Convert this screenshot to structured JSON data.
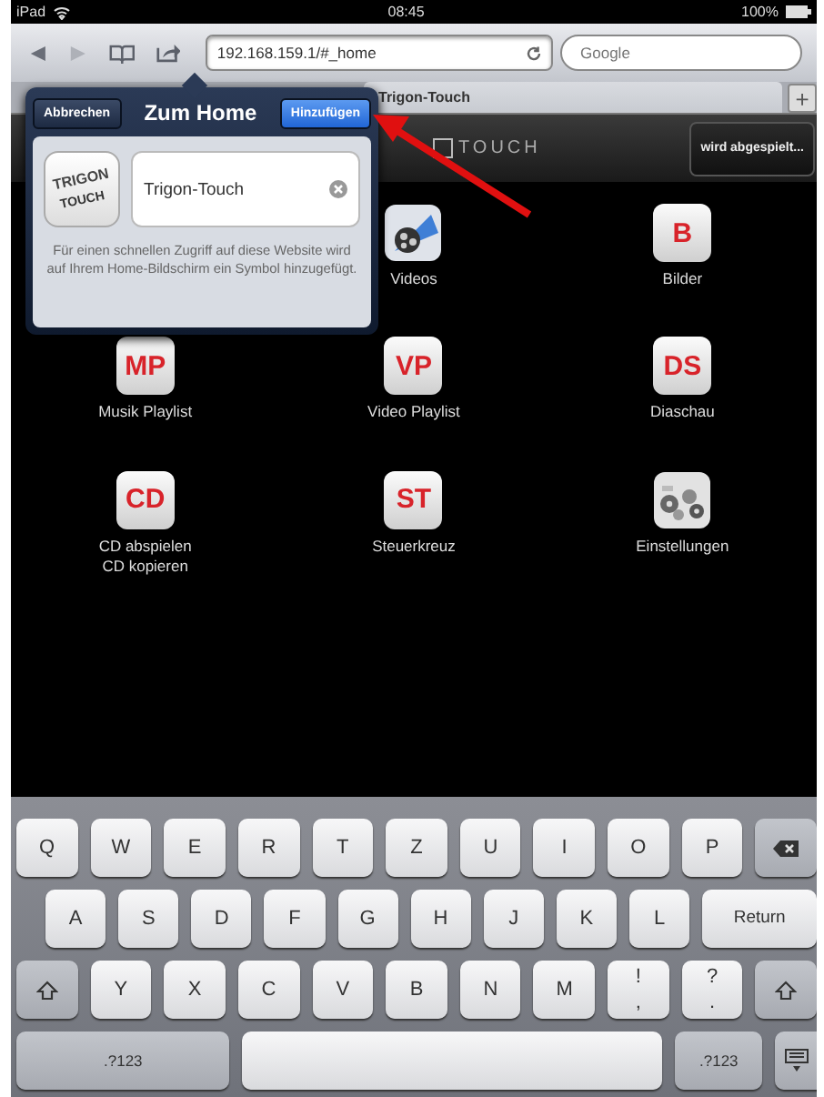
{
  "status_bar": {
    "device": "iPad",
    "time": "08:45",
    "battery": "100%"
  },
  "toolbar": {
    "url": "192.168.159.1/#_home",
    "search_placeholder": "Google"
  },
  "tab_bar": {
    "tab": "Trigon-Touch",
    "new_tab": "+"
  },
  "page": {
    "logo_text": "TOUCH",
    "now_playing": "wird abgespielt...",
    "tiles": [
      [
        {
          "kind": "film",
          "label": "Videos"
        },
        {
          "kind": "letters",
          "letters": "B",
          "label": "Bilder"
        }
      ],
      [
        {
          "kind": "letters",
          "letters": "MP",
          "label": "Musik Playlist"
        },
        {
          "kind": "letters",
          "letters": "VP",
          "label": "Video Playlist"
        },
        {
          "kind": "letters",
          "letters": "DS",
          "label": "Diaschau"
        }
      ],
      [
        {
          "kind": "letters",
          "letters": "CD",
          "label": "CD abspielen\nCD kopieren"
        },
        {
          "kind": "letters",
          "letters": "ST",
          "label": "Steuerkreuz"
        },
        {
          "label": "Einstellungen"
        }
      ]
    ]
  },
  "popover": {
    "cancel": "Abbrechen",
    "title": "Zum Home",
    "add": "Hinzufügen",
    "icon_lines": [
      "TRIGON",
      "TOUCH"
    ],
    "name_value": "Trigon-Touch",
    "hint": "Für einen schnellen Zugriff auf diese Website wird auf Ihrem Home-Bildschirm ein Symbol hinzugefügt."
  },
  "keyboard": {
    "letter_row_top": [
      {
        "kind": "char",
        "label": "Q"
      },
      {
        "kind": "char",
        "label": "W"
      },
      {
        "kind": "char",
        "label": "E"
      },
      {
        "kind": "char",
        "label": "R"
      },
      {
        "kind": "char",
        "label": "T"
      },
      {
        "kind": "char",
        "label": "Z"
      },
      {
        "kind": "char",
        "label": "U"
      },
      {
        "kind": "char",
        "label": "I"
      },
      {
        "kind": "char",
        "label": "O"
      },
      {
        "kind": "char",
        "label": "P"
      },
      {
        "kind": "backspace"
      }
    ],
    "letter_row_middle": [
      {
        "kind": "char",
        "label": "A"
      },
      {
        "kind": "char",
        "label": "S"
      },
      {
        "kind": "char",
        "label": "D"
      },
      {
        "kind": "char",
        "label": "F"
      },
      {
        "kind": "char",
        "label": "G"
      },
      {
        "kind": "char",
        "label": "H"
      },
      {
        "kind": "char",
        "label": "J"
      },
      {
        "kind": "char",
        "label": "K"
      },
      {
        "kind": "char",
        "label": "L"
      },
      {
        "kind": "wide",
        "label": "Return"
      }
    ],
    "letter_row_bottom": [
      {
        "kind": "shift"
      },
      {
        "kind": "char",
        "label": "Y"
      },
      {
        "kind": "char",
        "label": "X"
      },
      {
        "kind": "char",
        "label": "C"
      },
      {
        "kind": "char",
        "label": "V"
      },
      {
        "kind": "char",
        "label": "B"
      },
      {
        "kind": "char",
        "label": "N"
      },
      {
        "kind": "char",
        "label": "M"
      },
      {
        "kind": "punct",
        "label": "!",
        "sub": ","
      },
      {
        "kind": "punct",
        "label": "?",
        "sub": "."
      },
      {
        "kind": "shift"
      }
    ],
    "function_row": [
      {
        "kind": "numbers",
        "label": ".?123"
      },
      {
        "kind": "space"
      },
      {
        "kind": "numbers_small",
        "label": ".?123"
      },
      {
        "kind": "hide"
      }
    ]
  }
}
